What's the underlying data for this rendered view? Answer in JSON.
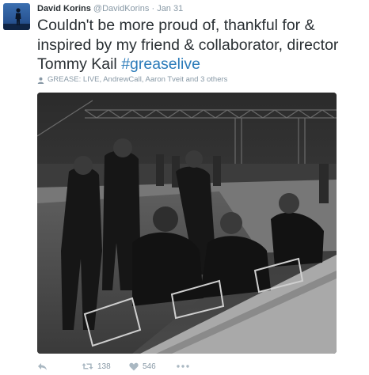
{
  "tweet": {
    "author_name": "David Korins",
    "handle": "@DavidKorins",
    "separator": "·",
    "timestamp": "Jan 31",
    "text_main": "Couldn't be more proud of, thankful for & inspired by my friend & collaborator, director Tommy Kail ",
    "hashtag": "#greaselive",
    "tagged": "GREASE: LIVE, AndrewCall, Aaron Tveit and 3 others"
  },
  "actions": {
    "retweet_count": "138",
    "like_count": "546"
  },
  "colors": {
    "link": "#2b7bb9",
    "muted": "#8899a6",
    "text": "#292f33"
  },
  "icons": [
    "person-silhouette-icon",
    "person-icon",
    "reply-icon",
    "retweet-icon",
    "heart-icon",
    "more-icon"
  ]
}
